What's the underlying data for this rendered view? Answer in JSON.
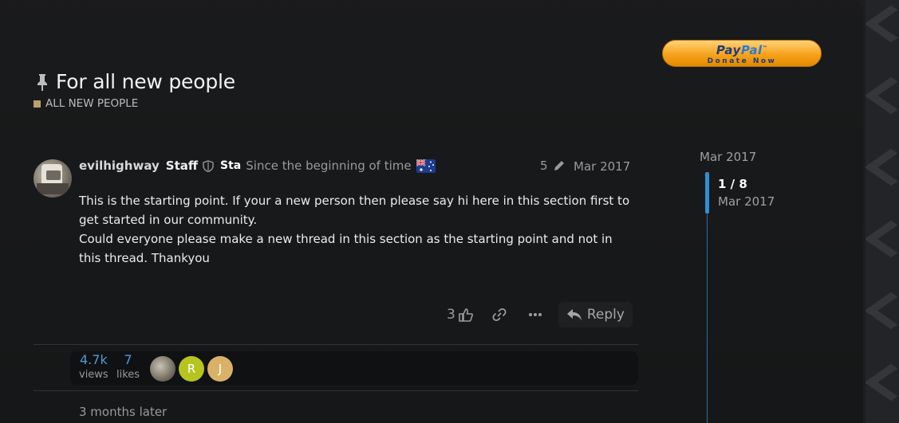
{
  "topic": {
    "title": "For all new people",
    "category": "ALL NEW PEOPLE",
    "category_color": "#b8a06a"
  },
  "donate": {
    "brand_a": "Pay",
    "brand_b": "Pal",
    "tm": "™",
    "label": "Donate Now"
  },
  "post": {
    "username": "evilhighway",
    "group": "Staff",
    "flair": "Sta",
    "user_title": "Since the beginning of time",
    "edit_count": "5",
    "date": "Mar 2017",
    "body": [
      "This is the starting point. If your a new person then please say hi here in this section first to get started in our community.",
      "Could everyone please make a new thread in this section as the starting point and not in this thread. Thankyou"
    ],
    "like_count": "3",
    "reply_label": "Reply"
  },
  "summary": {
    "views": "4.7k",
    "views_label": "views",
    "likes": "7",
    "likes_label": "likes",
    "participants": [
      {
        "initial": "",
        "color": "#6a645a"
      },
      {
        "initial": "R",
        "color": "#b5c41f"
      },
      {
        "initial": "J",
        "color": "#d9b267"
      }
    ]
  },
  "gap_text": "3 months later",
  "timeline": {
    "start_date": "Mar 2017",
    "position": "1 / 8",
    "current_date": "Mar 2017"
  },
  "colors": {
    "accent": "#2e8fd6",
    "background": "#161718"
  }
}
